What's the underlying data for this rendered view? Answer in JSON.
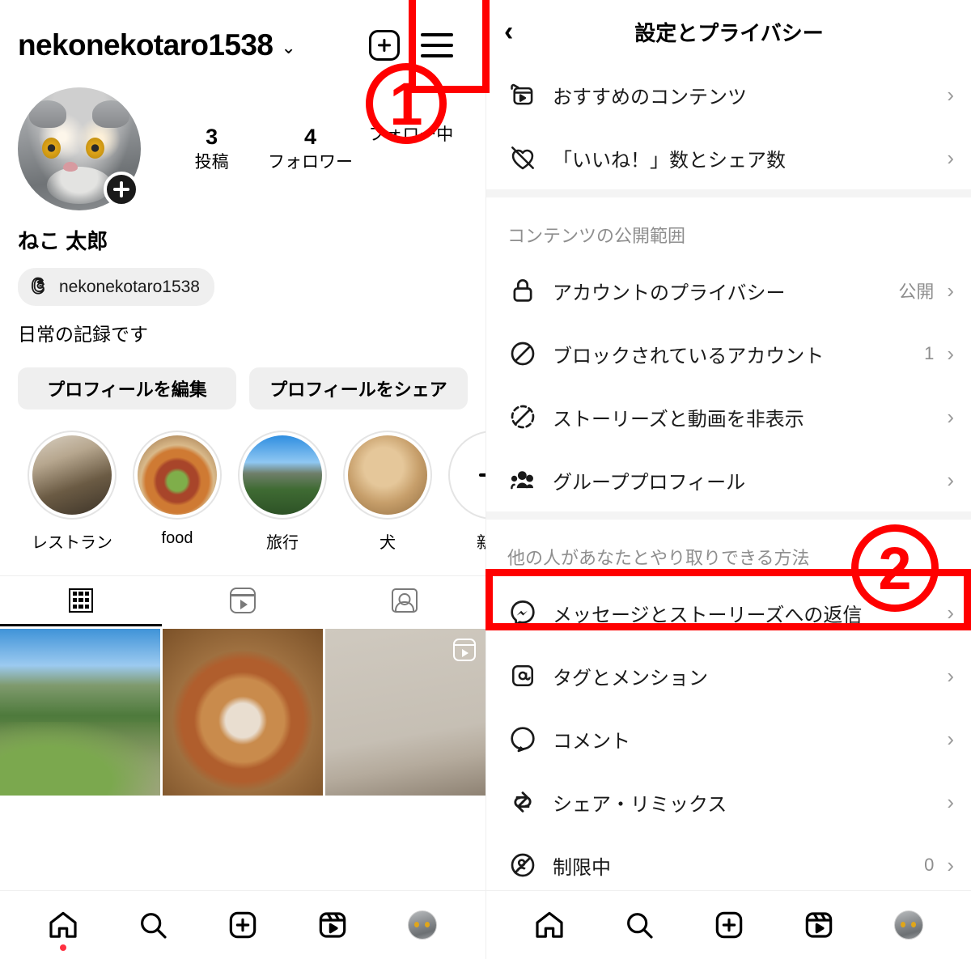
{
  "left": {
    "header": {
      "username": "nekonekotaro1538",
      "dropdown_icon": "chevron-down",
      "new_post_icon": "plus-square",
      "menu_icon": "hamburger"
    },
    "profile": {
      "avatar_add_icon": "plus",
      "stats": [
        {
          "num": "3",
          "label": "投稿"
        },
        {
          "num": "4",
          "label": "フォロワー"
        },
        {
          "num": "",
          "label": "フォロー中"
        }
      ],
      "display_name": "ねこ 太郎",
      "threads_handle": "nekonekotaro1538",
      "threads_icon": "threads-icon",
      "bio": "日常の記録です",
      "buttons": {
        "edit": "プロフィールを編集",
        "share": "プロフィールをシェア"
      }
    },
    "highlights": [
      {
        "label": "レストラン",
        "img": "img-restaurant"
      },
      {
        "label": "food",
        "img": "img-food"
      },
      {
        "label": "旅行",
        "img": "img-travel"
      },
      {
        "label": "犬",
        "img": "img-dog"
      },
      {
        "label": "新規",
        "img": "new"
      }
    ],
    "tabs": [
      {
        "icon": "grid-icon",
        "active": true
      },
      {
        "icon": "reels-icon",
        "active": false
      },
      {
        "icon": "tagged-icon",
        "active": false
      }
    ],
    "photos": [
      {
        "name": "photo-mountain-park"
      },
      {
        "name": "photo-food-plate"
      },
      {
        "name": "photo-room-wall",
        "badge": "reel-icon"
      }
    ]
  },
  "right": {
    "header": {
      "back_icon": "back-chevron",
      "title": "設定とプライバシー"
    },
    "groups": [
      {
        "title": "",
        "rows": [
          {
            "icon": "suggested-content-icon",
            "label": "おすすめのコンテンツ",
            "value": ""
          },
          {
            "icon": "like-share-count-icon",
            "label": "「いいね！」数とシェア数",
            "value": ""
          }
        ]
      },
      {
        "title": "コンテンツの公開範囲",
        "rows": [
          {
            "icon": "lock-icon",
            "label": "アカウントのプライバシー",
            "value": "公開"
          },
          {
            "icon": "block-icon",
            "label": "ブロックされているアカウント",
            "value": "1"
          },
          {
            "icon": "hide-story-icon",
            "label": "ストーリーズと動画を非表示",
            "value": ""
          },
          {
            "icon": "group-profile-icon",
            "label": "グループプロフィール",
            "value": ""
          }
        ]
      },
      {
        "title": "他の人があなたとやり取りできる方法",
        "rows": [
          {
            "icon": "messenger-icon",
            "label": "メッセージとストーリーズへの返信",
            "value": ""
          },
          {
            "icon": "tag-mention-icon",
            "label": "タグとメンション",
            "value": ""
          },
          {
            "icon": "comment-icon",
            "label": "コメント",
            "value": ""
          },
          {
            "icon": "share-remix-icon",
            "label": "シェア・リミックス",
            "value": ""
          },
          {
            "icon": "restricted-icon",
            "label": "制限中",
            "value": "0"
          }
        ]
      }
    ],
    "chevron": "›"
  },
  "bottom_nav": [
    {
      "icon": "home-icon",
      "badge": true
    },
    {
      "icon": "search-icon",
      "badge": false
    },
    {
      "icon": "create-icon",
      "badge": false
    },
    {
      "icon": "reels-icon",
      "badge": false
    },
    {
      "icon": "profile-avatar",
      "badge": false
    }
  ],
  "annotations": [
    {
      "id": "1",
      "label": "1",
      "target": "hamburger-menu"
    },
    {
      "id": "2",
      "label": "2",
      "target": "messages-and-story-replies-row"
    }
  ],
  "colors": {
    "accent_red": "#ff0000",
    "notification_dot": "#ff3040",
    "muted_text": "#8e8e8e",
    "chip_bg": "#efefef"
  }
}
